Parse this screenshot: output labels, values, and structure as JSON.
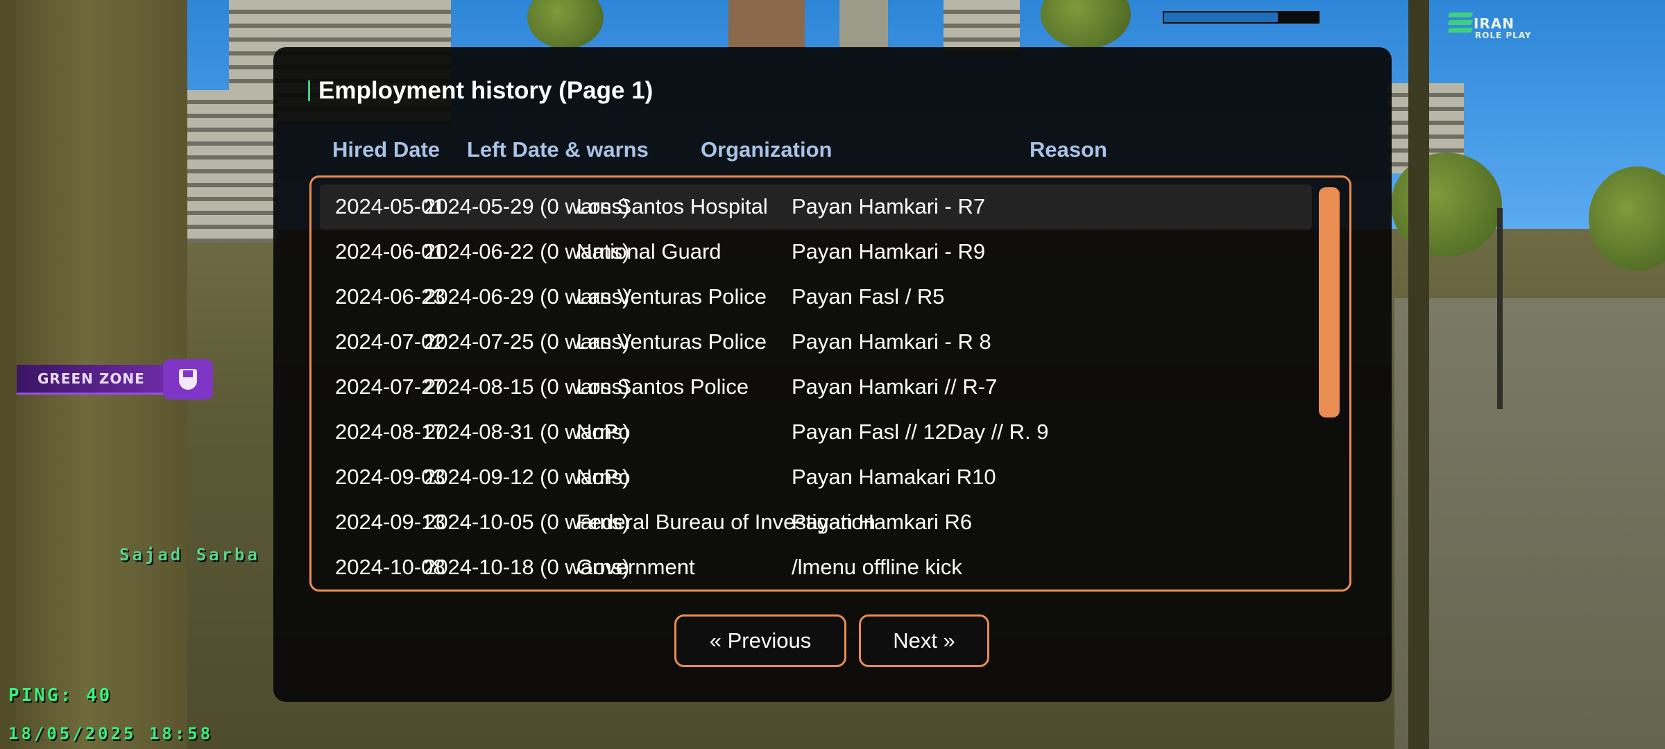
{
  "hud": {
    "health_fraction": 0.74,
    "logo_line1": "IRAN",
    "logo_line2": "ROLE PLAY",
    "zone_label": "GREEN ZONE",
    "player_tag": "Sajad Sarba",
    "ping": "PING: 40",
    "datetime": "18/05/2025 18:58"
  },
  "dialog": {
    "title": "Employment history (Page 1)",
    "columns": [
      "Hired Date",
      "Left Date & warns",
      "Organization",
      "Reason"
    ],
    "rows": [
      {
        "hired": "2024-05-01",
        "left": "2024-05-29 (0 warns)",
        "org": "Los Santos Hospital",
        "reason": "Payan Hamkari - R7"
      },
      {
        "hired": "2024-06-01",
        "left": "2024-06-22 (0 warns)",
        "org": "National Guard",
        "reason": "Payan Hamkari - R9"
      },
      {
        "hired": "2024-06-23",
        "left": "2024-06-29 (0 warns)",
        "org": "Las Venturas Police",
        "reason": "Payan Fasl / R5"
      },
      {
        "hired": "2024-07-02",
        "left": "2024-07-25 (0 warns)",
        "org": "Las Venturas Police",
        "reason": "Payan Hamkari - R 8"
      },
      {
        "hired": "2024-07-27",
        "left": "2024-08-15 (0 warns)",
        "org": "Los Santos Police",
        "reason": "Payan Hamkari // R-7"
      },
      {
        "hired": "2024-08-17",
        "left": "2024-08-31 (0 warns)",
        "org": "NoPo",
        "reason": "Payan Fasl // 12Day // R. 9"
      },
      {
        "hired": "2024-09-03",
        "left": "2024-09-12 (0 warns)",
        "org": "NoPo",
        "reason": "Payan Hamakari R10"
      },
      {
        "hired": "2024-09-13",
        "left": "2024-10-05 (0 warns)",
        "org": "Federal Bureau of Investigation",
        "reason": "Payan Hamkari R6"
      },
      {
        "hired": "2024-10-08",
        "left": "2024-10-18 (0 warns)",
        "org": "Government",
        "reason": "/lmenu offline kick"
      }
    ],
    "selected_row": 0,
    "prev_label": "« Previous",
    "next_label": "Next »"
  },
  "colors": {
    "accent": "#ea8d52",
    "header_text": "#a9c3e6",
    "zone_purple": "#7f36c6",
    "hud_green": "#38f07a"
  }
}
